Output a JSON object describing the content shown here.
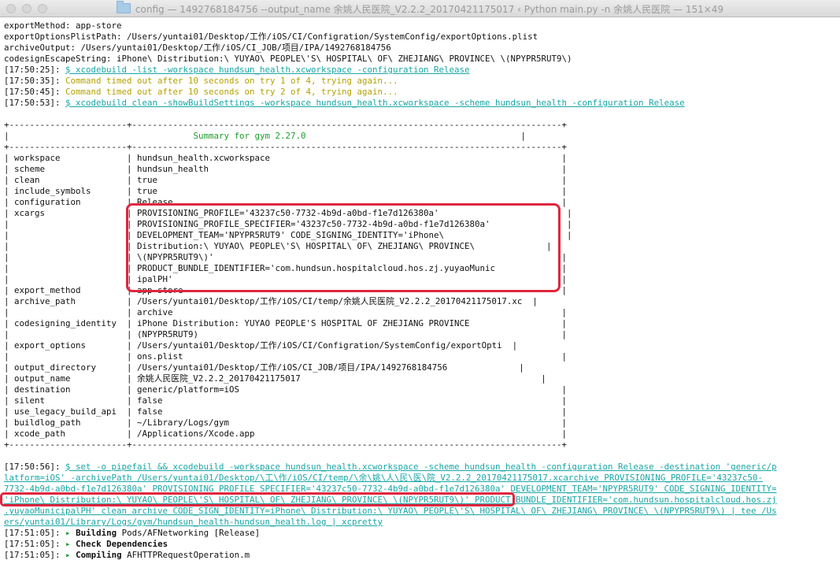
{
  "window": {
    "title": "config — 1492768184756 --output_name 余姚人民医院_V2.2.2_20170421175017 ‹ Python main.py -n 余姚人民医院 — 151×49"
  },
  "colors": {
    "command": "#19a6a6",
    "warning": "#b5a100",
    "summary": "#1c9c2a",
    "highlight": "#e0263f"
  },
  "lines": [
    "exportMethod: app-store",
    "exportOptionsPlistPath: /Users/yuntai01/Desktop/工作/iOS/CI/Configration/SystemConfig/exportOptions.plist",
    "archiveOutput: /Users/yuntai01/Desktop/工作/iOS/CI_JOB/项目/IPA/1492768184756",
    "codesignEscapeString: iPhone\\ Distribution:\\ YUYAO\\ PEOPLE\\'S\\ HOSPITAL\\ OF\\ ZHEJIANG\\ PROVINCE\\ \\(NPYPR5RUT9\\)"
  ],
  "log": [
    {
      "ts": "[17:50:25]:",
      "text": "$ xcodebuild -list -workspace hundsun_health.xcworkspace -configuration Release"
    },
    {
      "ts": "[17:50:35]:",
      "text": "Command timed out after 10 seconds on try 1 of 4, trying again..."
    },
    {
      "ts": "[17:50:45]:",
      "text": "Command timed out after 10 seconds on try 2 of 4, trying again..."
    },
    {
      "ts": "[17:50:53]:",
      "text": "$ xcodebuild clean -showBuildSettings -workspace hundsun_health.xcworkspace -scheme hundsun_health -configuration Release"
    }
  ],
  "table": {
    "border": "+-----------------------+------------------------------------------------------------------------------------+",
    "title": "Summary for gym 2.27.0",
    "rows": [
      "| workspace             | hundsun_health.xcworkspace                                                         |",
      "| scheme                | hundsun_health                                                                     |",
      "| clean                 | true                                                                               |",
      "| include_symbols       | true                                                                               |",
      "| configuration         | Release                                                                            |",
      "| xcargs                | PROVISIONING_PROFILE='43237c50-7732-4b9d-a0bd-f1e7d126380a'                         |",
      "|                       | PROVISIONING_PROFILE_SPECIFIER='43237c50-7732-4b9d-a0bd-f1e7d126380a'               |",
      "|                       | DEVELOPMENT_TEAM='NPYPR5RUT9' CODE_SIGNING_IDENTITY='iPhone\\                        |",
      "|                       | Distribution:\\ YUYAO\\ PEOPLE\\'S\\ HOSPITAL\\ OF\\ ZHEJIANG\\ PROVINCE\\              |",
      "|                       | \\(NPYPR5RUT9\\)'                                                                    |",
      "|                       | PRODUCT_BUNDLE_IDENTIFIER='com.hundsun.hospitalcloud.hos.zj.yuyaoMunic             |",
      "|                       | ipalPH'                                                                            |",
      "| export_method         | app-store                                                                          |",
      "| archive_path          | /Users/yuntai01/Desktop/工作/iOS/CI/temp/余姚人民医院_V2.2.2_20170421175017.xc  |",
      "|                       | archive                                                                            |",
      "| codesigning_identity  | iPhone Distribution: YUYAO PEOPLE'S HOSPITAL OF ZHEJIANG PROVINCE                  |",
      "|                       | (NPYPR5RUT9)                                                                       |",
      "| export_options        | /Users/yuntai01/Desktop/工作/iOS/CI/Configration/SystemConfig/exportOpti  |",
      "|                       | ons.plist                                                                          |",
      "| output_directory      | /Users/yuntai01/Desktop/工作/iOS/CI_JOB/项目/IPA/1492768184756              |",
      "| output_name           | 余姚人民医院_V2.2.2_20170421175017                                               |",
      "| destination           | generic/platform=iOS                                                               |",
      "| silent                | false                                                                              |",
      "| use_legacy_build_api  | false                                                                              |",
      "| buildlog_path         | ~/Library/Logs/gym                                                                 |",
      "| xcode_path            | /Applications/Xcode.app                                                            |"
    ]
  },
  "final_cmd": {
    "ts": "[17:50:56]:",
    "lines": [
      "$ set -o pipefail && xcodebuild -workspace hundsun_health.xcworkspace -scheme hundsun_health -configuration Release -destination 'generic/p",
      "latform=iOS' -archivePath /Users/yuntai01/Desktop/\\工\\作/iOS/CI/temp/\\余\\姚\\人\\民\\医\\院_V2.2.2_20170421175017.xcarchive PROVISIONING_PROFILE='43237c50-",
      "7732-4b9d-a0bd-f1e7d126380a' PROVISIONING_PROFILE_SPECIFIER='43237c50-7732-4b9d-a0bd-f1e7d126380a' DEVELOPMENT_TEAM='NPYPR5RUT9' CODE_SIGNING_IDENTITY=",
      "'iPhone\\ Distribution:\\ YUYAO\\ PEOPLE\\'S\\ HOSPITAL\\ OF\\ ZHEJIANG\\ PROVINCE\\ \\(NPYPR5RUT9\\)' PRODUCT_BUNDLE_IDENTIFIER='com.hundsun.hospitalcloud.hos.zj",
      ".yuyaoMunicipalPH' clean archive CODE_SIGN_IDENTITY=iPhone\\ Distribution:\\ YUYAO\\ PEOPLE\\'S\\ HOSPITAL\\ OF\\ ZHEJIANG\\ PROVINCE\\ \\(NPYPR5RUT9\\) | tee /Us",
      "ers/yuntai01/Library/Logs/gym/hundsun_health-hundsun_health.log | xcpretty"
    ]
  },
  "build_steps": [
    {
      "ts": "[17:51:05]:",
      "arrow": "▸",
      "action": "Building",
      "detail": "Pods/AFNetworking [Release]"
    },
    {
      "ts": "[17:51:05]:",
      "arrow": "▸",
      "action": "Check Dependencies",
      "detail": ""
    },
    {
      "ts": "[17:51:05]:",
      "arrow": "▸",
      "action": "Compiling",
      "detail": "AFHTTPRequestOperation.m"
    }
  ]
}
